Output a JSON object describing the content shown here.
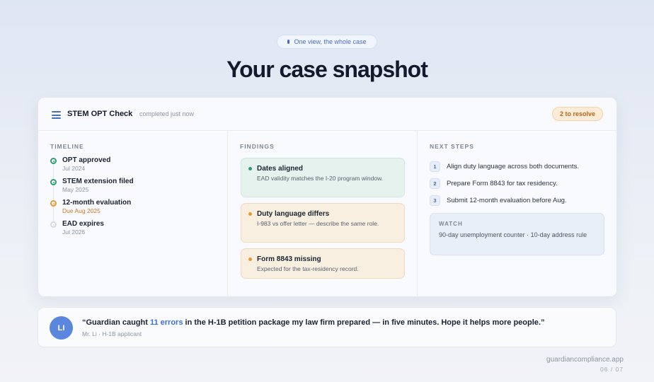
{
  "eyebrow": "One view, the whole case",
  "hero_title": "Your case snapshot",
  "check": {
    "title": "STEM OPT Check",
    "subtitle": "completed just now",
    "badge": "2 to resolve"
  },
  "timeline": {
    "heading": "TIMELINE",
    "items": [
      {
        "name": "OPT approved",
        "date": "Jul 2024",
        "status": "done"
      },
      {
        "name": "STEM extension filed",
        "date": "May 2025",
        "status": "done"
      },
      {
        "name": "12-month evaluation",
        "date": "Due Aug 2025",
        "status": "due"
      },
      {
        "name": "EAD expires",
        "date": "Jul 2026",
        "status": "future"
      }
    ]
  },
  "findings": {
    "heading": "FINDINGS",
    "items": [
      {
        "title": "Dates aligned",
        "desc": "EAD validity matches the I-20 program window.",
        "status": "ok"
      },
      {
        "title": "Duty language differs",
        "desc": "I-983 vs offer letter — describe the same role.",
        "status": "warn"
      },
      {
        "title": "Form 8843 missing",
        "desc": "Expected for the tax-residency record.",
        "status": "warn"
      }
    ]
  },
  "next_steps": {
    "heading": "NEXT STEPS",
    "items": [
      {
        "num": "1",
        "text": "Align duty language across both documents."
      },
      {
        "num": "2",
        "text": "Prepare Form 8843 for tax residency."
      },
      {
        "num": "3",
        "text": "Submit 12-month evaluation before Aug."
      }
    ],
    "watch_title": "WATCH",
    "watch_text": "90-day unemployment counter · 10-day address rule"
  },
  "testimonial": {
    "initials": "LI",
    "quote_before": "“Guardian caught ",
    "quote_highlight": "11 errors",
    "quote_after": " in the H-1B petition package my law firm prepared — in five minutes. Hope it helps more people.”",
    "author": "Mr. Li · H-1B applicant"
  },
  "footer": {
    "url": "guardiancompliance.app",
    "page": "06 / 07"
  },
  "colors": {
    "accent": "#4a6bc4",
    "ok": "#2e9c73",
    "warn": "#e39a36",
    "highlight": "#3d6fd9"
  }
}
